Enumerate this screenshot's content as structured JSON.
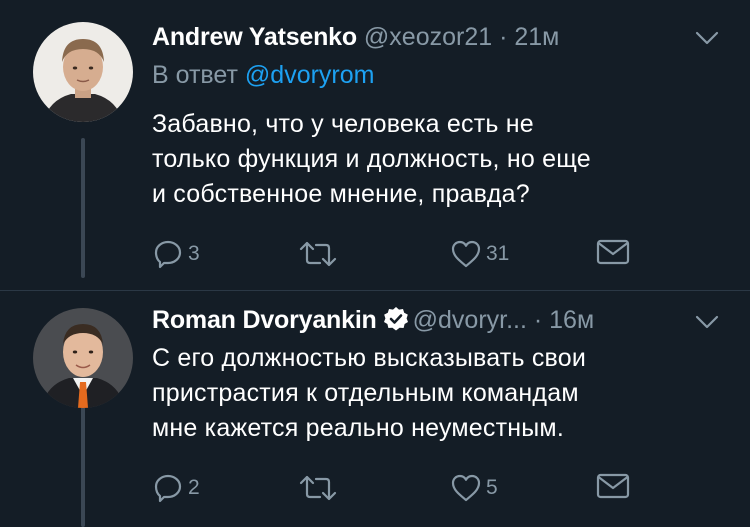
{
  "tweets": [
    {
      "author_name": "Andrew Yatsenko",
      "handle": "@xeozor21",
      "separator": " · ",
      "time": "21м",
      "reply_prefix": "В ответ ",
      "reply_mention": "@dvoryrom",
      "text_lines": [
        "Забавно, что у человека есть не",
        "только функция и должность, но еще",
        "и собственное мнение, правда?"
      ],
      "replies": "3",
      "retweets": "",
      "likes": "31"
    },
    {
      "author_name": "Roman Dvoryankin",
      "verified": true,
      "handle": "@dvoryr...",
      "separator": " · ",
      "time": "16м",
      "text_lines": [
        "С его должностью высказывать свои",
        "пристрастия к отдельным командам",
        "мне кажется реально неуместным."
      ],
      "replies": "2",
      "retweets": "",
      "likes": "5"
    }
  ],
  "icons": {
    "reply": "reply-icon",
    "retweet": "retweet-icon",
    "like": "heart-icon",
    "dm": "envelope-icon",
    "menu": "chevron-down-icon",
    "verified": "verified-badge-icon"
  },
  "colors": {
    "background": "#141d26",
    "secondary_text": "#8899a6",
    "mention": "#1da1f2"
  }
}
